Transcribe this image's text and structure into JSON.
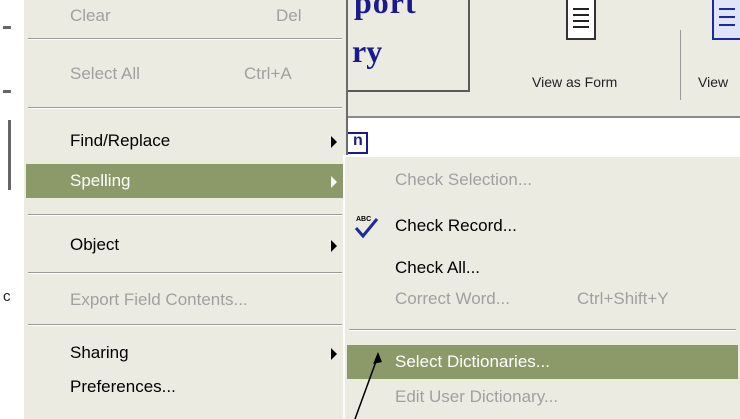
{
  "background": {
    "logo_line1": "port",
    "logo_line2": "ry",
    "view_form_label": "View as Form",
    "view_list_label": "View",
    "tab_letter": "n",
    "left_fragment_char": "c"
  },
  "edit_menu": {
    "items": [
      {
        "label": "Clear",
        "shortcut": "Del",
        "enabled": false
      },
      {
        "label": "Select All",
        "shortcut": "Ctrl+A",
        "enabled": false
      },
      {
        "label": "Find/Replace",
        "has_submenu": true,
        "enabled": true
      },
      {
        "label": "Spelling",
        "has_submenu": true,
        "enabled": true,
        "highlighted": true
      },
      {
        "label": "Object",
        "has_submenu": true,
        "enabled": true
      },
      {
        "label": "Export Field Contents...",
        "enabled": false
      },
      {
        "label": "Sharing",
        "has_submenu": true,
        "enabled": true
      },
      {
        "label": "Preferences...",
        "enabled": true
      }
    ]
  },
  "spelling_submenu": {
    "items": [
      {
        "label": "Check Selection...",
        "enabled": false
      },
      {
        "label": "Check Record...",
        "enabled": true,
        "icon": "spell-check-icon"
      },
      {
        "label": "Check All...",
        "enabled": true
      },
      {
        "label": "Correct Word...",
        "shortcut": "Ctrl+Shift+Y",
        "enabled": false
      },
      {
        "label": "Select Dictionaries...",
        "enabled": true,
        "highlighted": true
      },
      {
        "label": "Edit User Dictionary...",
        "enabled": false
      }
    ]
  },
  "colors": {
    "menu_bg": "#ecebe2",
    "highlight": "#8c9a6a",
    "disabled_text": "#a0a0a0",
    "logo_text": "#1a1a8c"
  }
}
